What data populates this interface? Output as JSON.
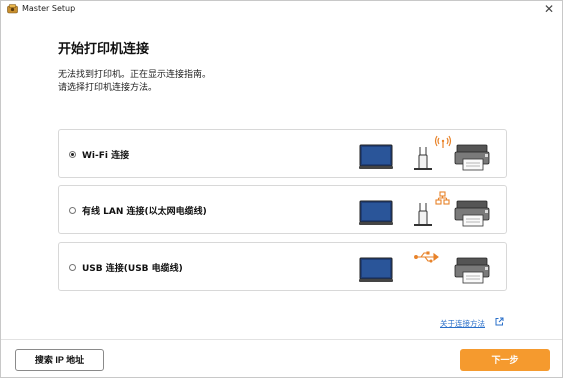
{
  "window": {
    "title": "Master Setup"
  },
  "page": {
    "heading": "开始打印机连接",
    "description_line1": "无法找到打印机。正在显示连接指南。",
    "description_line2": "请选择打印机连接方法。"
  },
  "options": [
    {
      "label": "Wi-Fi 连接",
      "selected": true,
      "illustration": "laptop-router-printer-wifi"
    },
    {
      "label": "有线 LAN 连接(以太网电缆线)",
      "selected": false,
      "illustration": "laptop-router-printer-lan"
    },
    {
      "label": "USB 连接(USB 电缆线)",
      "selected": false,
      "illustration": "laptop-printer-usb"
    }
  ],
  "help_link": {
    "label": "关于连接方法",
    "icon": "external-link-icon"
  },
  "footer": {
    "search_ip_label": "搜索 IP 地址",
    "next_label": "下一步"
  },
  "colors": {
    "accent": "#f59a2e",
    "link": "#2a6fc9",
    "signal": "#e8832a"
  }
}
